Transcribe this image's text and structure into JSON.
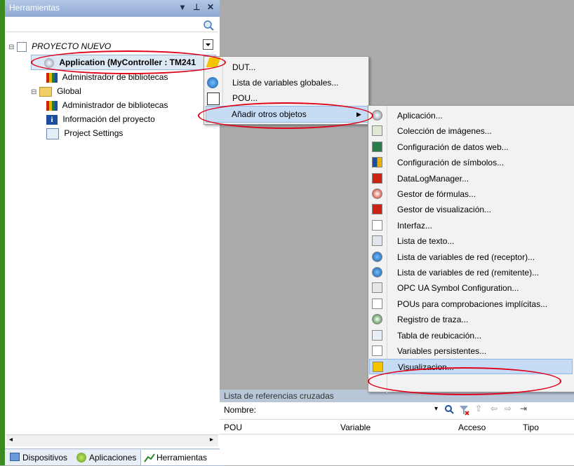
{
  "panel": {
    "title": "Herramientas",
    "pin": "▾  ⊥  ✕"
  },
  "tree": {
    "project": "PROYECTO NUEVO",
    "application": "Application (MyController : TM241",
    "app_child": "Administrador de bibliotecas",
    "global": "Global",
    "global_children": [
      "Administrador de bibliotecas",
      "Información del proyecto",
      "Project Settings"
    ]
  },
  "menu1": {
    "items": [
      "DUT...",
      "Lista de variables globales...",
      "POU...",
      "Añadir otros objetos"
    ]
  },
  "menu2": {
    "items": [
      "Aplicación...",
      "Colección de imágenes...",
      "Configuración de datos web...",
      "Configuración de símbolos...",
      "DataLogManager...",
      "Gestor de fórmulas...",
      "Gestor de visualización...",
      "Interfaz...",
      "Lista de texto...",
      "Lista de variables de red (receptor)...",
      "Lista de variables de red (remitente)...",
      "OPC UA Symbol Configuration...",
      "POUs para comprobaciones implícitas...",
      "Registro de traza...",
      "Tabla de reubicación...",
      "Variables persistentes...",
      "Visualizacion..."
    ]
  },
  "xref": {
    "title": "Lista de referencias cruzadas",
    "name_label": "Nombre:",
    "columns": [
      "POU",
      "Variable",
      "Acceso",
      "Tipo"
    ]
  },
  "tabs": [
    "Dispositivos",
    "Aplicaciones",
    "Herramientas"
  ],
  "colors": {
    "accent_ring": "#e0001a",
    "highlight": "#c6dcf5",
    "side_bar": "#3a8a1f"
  }
}
